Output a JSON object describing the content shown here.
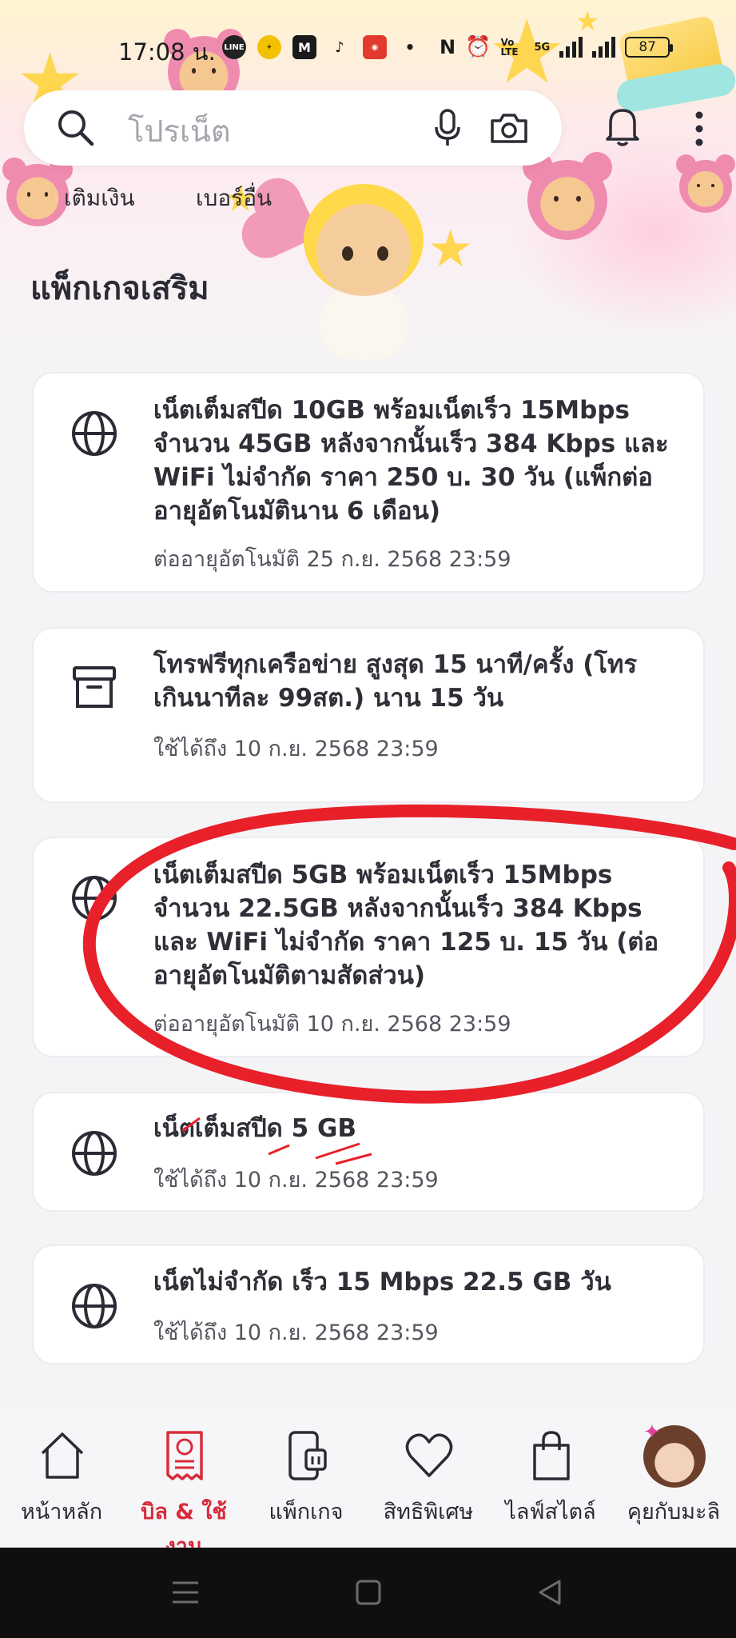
{
  "status_bar": {
    "time": "17:08 น.",
    "network": "5G",
    "volte": "Vo LTE",
    "battery": "87"
  },
  "search": {
    "placeholder": "โปรเน็ต"
  },
  "quick_links": [
    "เติมเงิน",
    "เบอร์อื่น"
  ],
  "section_title": "แพ็กเกจเสริม",
  "packages": [
    {
      "icon": "globe-icon",
      "title": "เน็ตเต็มสปีด 10GB พร้อมเน็ตเร็ว 15Mbps จำนวน 45GB หลังจากนั้นเร็ว 384 Kbps และ WiFi ไม่จำกัด ราคา 250 บ. 30 วัน (แพ็กต่ออายุอัตโนมัตินาน 6 เดือน)",
      "subtitle": "ต่ออายุอัตโนมัติ 25 ก.ย. 2568 23:59"
    },
    {
      "icon": "archive-box-icon",
      "title": "โทรฟรีทุกเครือข่าย สูงสุด 15 นาที/ครั้ง (โทรเกินนาทีละ 99สต.) นาน 15 วัน",
      "subtitle": "ใช้ได้ถึง 10 ก.ย. 2568 23:59"
    },
    {
      "icon": "globe-icon",
      "title": "เน็ตเต็มสปีด 5GB พร้อมเน็ตเร็ว 15Mbps จำนวน 22.5GB หลังจากนั้นเร็ว 384 Kbps และ WiFi ไม่จำกัด ราคา 125 บ. 15 วัน (ต่ออายุอัตโนมัติตามสัดส่วน)",
      "subtitle": "ต่ออายุอัตโนมัติ 10 ก.ย. 2568 23:59"
    },
    {
      "icon": "globe-icon",
      "title": "เน็ตเต็มสปีด 5 GB",
      "subtitle": "ใช้ได้ถึง 10 ก.ย. 2568 23:59"
    },
    {
      "icon": "globe-icon",
      "title": "เน็ตไม่จำกัด เร็ว 15 Mbps 22.5 GB วัน",
      "subtitle": "ใช้ได้ถึง 10 ก.ย. 2568 23:59"
    }
  ],
  "bottom_nav": [
    {
      "label": "หน้าหลัก",
      "icon": "home-icon",
      "active": false
    },
    {
      "label": "บิล & ใช้งาน",
      "icon": "bill-icon",
      "active": true
    },
    {
      "label": "แพ็กเกจ",
      "icon": "package-phone-icon",
      "active": false
    },
    {
      "label": "สิทธิพิเศษ",
      "icon": "heart-icon",
      "active": false
    },
    {
      "label": "ไลฟ์สไตล์",
      "icon": "shopping-bag-icon",
      "active": false
    },
    {
      "label": "คุยกับมะลิ",
      "icon": "assistant-avatar-icon",
      "active": false
    }
  ],
  "colors": {
    "accent": "#d82c3b",
    "annotation_red": "#e8202a",
    "text": "#2b2b35",
    "card_bg": "#ffffff",
    "page_bg": "#f4f4f6"
  }
}
